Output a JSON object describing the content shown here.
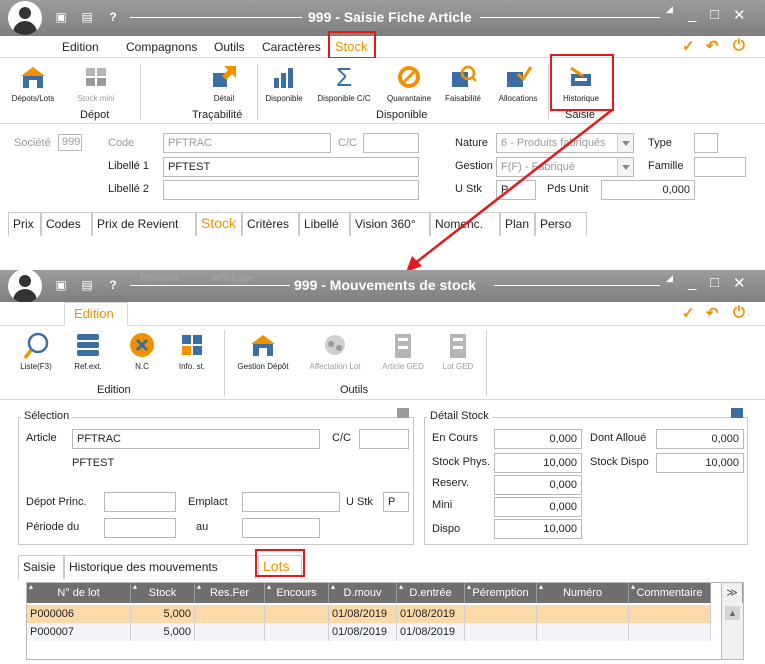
{
  "top_window": {
    "title": "999 - Saisie Fiche Article",
    "menu": [
      "Edition",
      "Compagnons",
      "Outils",
      "Caractères",
      "Stock"
    ],
    "ribbon": {
      "buttons": [
        "Dépots/Lots",
        "Stock mini",
        "Détail",
        "Disponible",
        "Disponible C/C",
        "Quarantaine",
        "Faisabilité",
        "Allocations",
        "Historique"
      ],
      "groups": [
        "Dépot",
        "Traçabilité",
        "Disponible",
        "Saisie"
      ]
    },
    "form": {
      "societe_label": "Société",
      "societe_value": "999",
      "code_label": "Code",
      "code_value": "PFTRAC",
      "cc_label": "C/C",
      "libelle1_label": "Libellé 1",
      "libelle1_value": "PFTEST",
      "libelle2_label": "Libellé 2",
      "nature_label": "Nature",
      "nature_value": "6 - Produits fabriqués",
      "gestion_label": "Gestion",
      "gestion_value": "F(F) - Fabriqué",
      "ustk_label": "U Stk",
      "ustk_value": "P",
      "pdsunit_label": "Pds Unit",
      "pdsunit_value": "0,000",
      "type_label": "Type",
      "famille_label": "Famille"
    },
    "tabs": [
      "Prix",
      "Codes",
      "Prix de Revient",
      "Stock",
      "Critères",
      "Libellé",
      "Vision 360°",
      "Nomenc.",
      "Plan",
      "Perso"
    ]
  },
  "bottom_window": {
    "title": "999 - Mouvements de stock",
    "menu": [
      "Edition"
    ],
    "ghost_menu": [
      "Révision",
      "Affichage"
    ],
    "ribbon": {
      "buttons": [
        "Liste(F3)",
        "Ref.ext.",
        "N.C",
        "Info. st.",
        "Gestion Dépôt",
        "Affectation Lot",
        "Article GED",
        "Lot GED"
      ],
      "groups": [
        "Edition",
        "Outils"
      ]
    },
    "selection": {
      "title": "Sélection",
      "article_label": "Article",
      "article_value": "PFTRAC",
      "cc_label": "C/C",
      "article_desc": "PFTEST",
      "depot_label": "Dépot Princ.",
      "emplact_label": "Emplact",
      "ustk_label": "U Stk",
      "ustk_value": "P",
      "periode_label": "Période du",
      "au_label": "au"
    },
    "detail": {
      "title": "Détail Stock",
      "encours_label": "En Cours",
      "encours_value": "0,000",
      "stockphys_label": "Stock Phys.",
      "stockphys_value": "10,000",
      "reserv_label": "Reserv.",
      "reserv_value": "0,000",
      "mini_label": "Mini",
      "mini_value": "0,000",
      "dispo_label": "Dispo",
      "dispo_value": "10,000",
      "dontalloue_label": "Dont Alloué",
      "dontalloue_value": "0,000",
      "stockdispo_label": "Stock Dispo",
      "stockdispo_value": "10,000"
    },
    "tabs": [
      "Saisie",
      "Historique des mouvements",
      "Lots"
    ],
    "table": {
      "columns": [
        "N° de lot",
        "Stock",
        "Res.Fer",
        "Encours",
        "D.mouv",
        "D.entrée",
        "Péremption",
        "Numéro",
        "Commentaire"
      ],
      "rows": [
        [
          "P000006",
          "5,000",
          "",
          "",
          "01/08/2019",
          "01/08/2019",
          "",
          "",
          ""
        ],
        [
          "P000007",
          "5,000",
          "",
          "",
          "01/08/2019",
          "01/08/2019",
          "",
          "",
          ""
        ]
      ]
    }
  },
  "colors": {
    "accent_orange": "#f29100",
    "highlight_red": "#e21a1a",
    "titlebar_gray": "#8a8a8a",
    "selected_row": "#fbd9a8",
    "icon_blue": "#3a6ea5"
  }
}
